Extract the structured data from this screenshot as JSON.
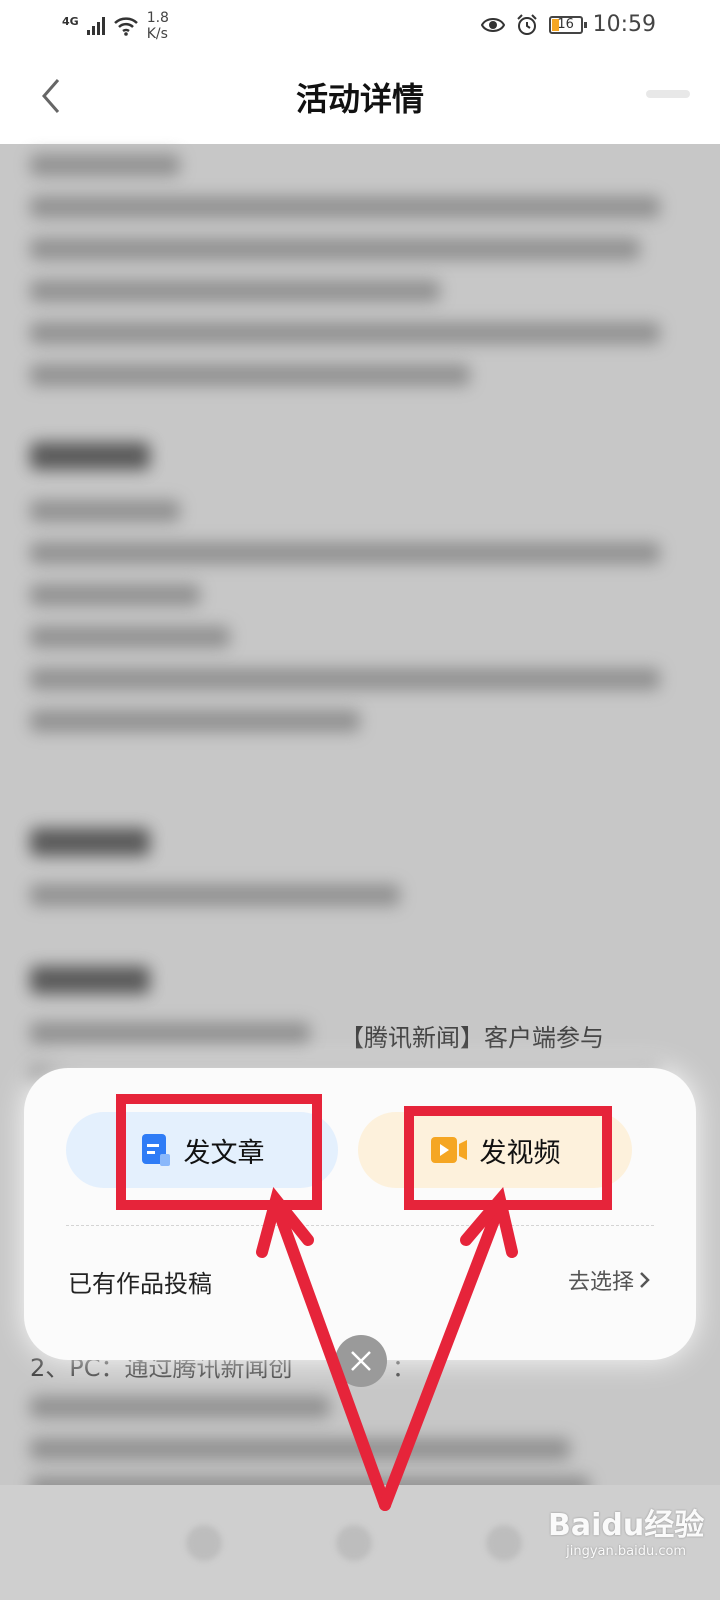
{
  "status_bar": {
    "network_type": "4G",
    "speed_value": "1.8",
    "speed_unit": "K/s",
    "battery_level": "16",
    "time": "10:59"
  },
  "header": {
    "title": "活动详情"
  },
  "content": {
    "visible_line_1": "【腾讯新闻】客户端参与",
    "visible_line_2": "2、PC：通过腾讯新闻创",
    "visible_line_3": "："
  },
  "popup": {
    "article_button": "发文章",
    "video_button": "发视频",
    "existing_works": "已有作品投稿",
    "choose_link": "去选择"
  },
  "watermark": {
    "brand": "Baidu经验",
    "url": "jingyan.baidu.com"
  },
  "colors": {
    "highlight": "#e6243a",
    "article_bg": "#e4f0fd",
    "video_bg": "#fdf1dc",
    "doc_icon": "#2f7cf6",
    "video_icon": "#f5a623"
  }
}
